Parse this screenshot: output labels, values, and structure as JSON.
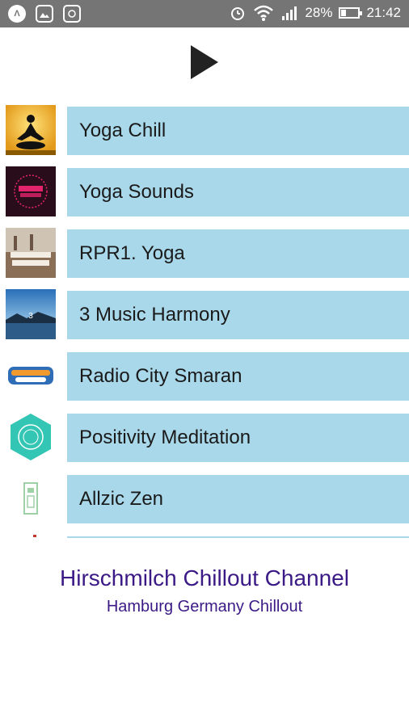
{
  "status_bar": {
    "battery": "28%",
    "battery_level": 0.28,
    "time": "21:42",
    "icons": [
      "app-icon",
      "image-icon",
      "file-icon",
      "alarm-icon",
      "wifi-icon",
      "signal-icon",
      "battery-icon"
    ]
  },
  "player": {
    "play_icon": "play-icon"
  },
  "stations": [
    {
      "name": "Yoga Chill",
      "thumb": "meditation-silhouette"
    },
    {
      "name": "Yoga Sounds",
      "thumb": "yoga-sounds-logo"
    },
    {
      "name": "RPR1. Yoga",
      "thumb": "yoga-sounds-beach"
    },
    {
      "name": "3 Music Harmony",
      "thumb": "harmony-lake"
    },
    {
      "name": "Radio City Smaran",
      "thumb": "radio-city-smaran-logo"
    },
    {
      "name": "Positivity Meditation",
      "thumb": "hexagon-logo"
    },
    {
      "name": "Allzic Zen",
      "thumb": "allzic-logo"
    },
    {
      "name": "",
      "thumb": "partial"
    }
  ],
  "footer": {
    "title": "Hirschmilch Chillout Channel",
    "subtitle": "Hamburg Germany Chillout"
  },
  "colors": {
    "tile": "#a9d8ea",
    "footer_text": "#3b1a86",
    "statusbar": "#757575"
  }
}
